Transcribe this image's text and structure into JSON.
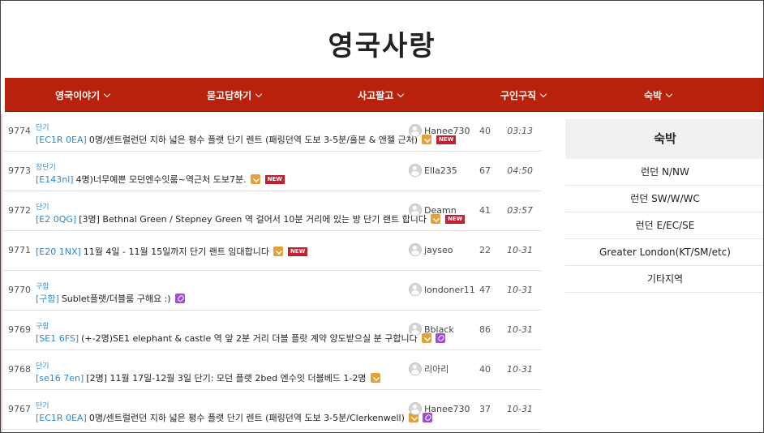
{
  "site": {
    "logo": "영국사랑"
  },
  "nav": [
    {
      "label": "영국이야기"
    },
    {
      "label": "묻고답하기"
    },
    {
      "label": "사고팔고"
    },
    {
      "label": "구인구직"
    },
    {
      "label": "숙박"
    }
  ],
  "posts": [
    {
      "num": "9774",
      "category": "단기",
      "tag": "[EC1R 0EA]",
      "title": "0명/센트럴런던 지하 넓은 평수 플랫 단기 렌트 (패링던역 도보 3-5분/홀본 & 앤젤 근처)",
      "download": true,
      "link": false,
      "new": true,
      "author": "Hanee730",
      "views": "40",
      "time": "03:13"
    },
    {
      "num": "9773",
      "category": "장단기",
      "tag": "[E143nl]",
      "title": "4명)너무예쁜 모던엔수잇룸~역근처 도보7분.",
      "download": true,
      "link": false,
      "new": true,
      "author": "Ella235",
      "views": "67",
      "time": "04:50"
    },
    {
      "num": "9772",
      "category": "단기",
      "tag": "[E2 0QG]",
      "title": "[3명] Bethnal Green / Stepney Green 역 걸어서 10분 거리에 있는 방 단기 랜트 합니다",
      "download": true,
      "link": false,
      "new": true,
      "author": "Deamn",
      "views": "41",
      "time": "03:57"
    },
    {
      "num": "9771",
      "category": "",
      "tag": "[E20 1NX]",
      "title": "11월 4일 - 11월 15일까지 단기 랜트 임대합니다",
      "download": true,
      "link": false,
      "new": true,
      "author": "jayseo",
      "views": "22",
      "time": "10-31"
    },
    {
      "num": "9770",
      "category": "구함",
      "tag": "[구함]",
      "title": "Sublet플랫/더블룸 구해요 :)",
      "download": false,
      "link": true,
      "new": false,
      "author": "londoner11",
      "views": "47",
      "time": "10-31"
    },
    {
      "num": "9769",
      "category": "구함",
      "tag": "[SE1 6FS]",
      "title": "(+-2명)SE1 elephant & castle 역 앞 2분 거리 더블 플랏 계약 양도받으실 분 구합니다",
      "download": true,
      "link": true,
      "new": false,
      "author": "Bblack",
      "views": "86",
      "time": "10-31"
    },
    {
      "num": "9768",
      "category": "단기",
      "tag": "[se16 7en]",
      "title": "[2명] 11월 17일-12월 3일 단기: 모던 플랫 2bed 엔수잇 더블베드 1-2명",
      "download": true,
      "link": false,
      "new": false,
      "author": "리아리",
      "views": "40",
      "time": "10-31"
    },
    {
      "num": "9767",
      "category": "단기",
      "tag": "[EC1R 0EA]",
      "title": "0명/센트럴런던 지하 넓은 평수 플랫 단기 렌트 (패링던역 도보 3-5분/Clerkenwell)",
      "download": true,
      "link": true,
      "new": false,
      "author": "Hanee730",
      "views": "37",
      "time": "10-31"
    }
  ],
  "sidebar": {
    "title": "숙박",
    "items": [
      {
        "label": "런던 N/NW"
      },
      {
        "label": "런던 SW/W/WC"
      },
      {
        "label": "런던 E/EC/SE"
      },
      {
        "label": "Greater London(KT/SM/etc)"
      },
      {
        "label": "기타지역"
      }
    ]
  },
  "new_badge_text": "NEW",
  "colors": {
    "nav_bg": "#b8220c",
    "tag": "#2f87cc",
    "new_badge": "#c21f2f",
    "download": "#e0a23a",
    "link": "#9c4fd6"
  }
}
